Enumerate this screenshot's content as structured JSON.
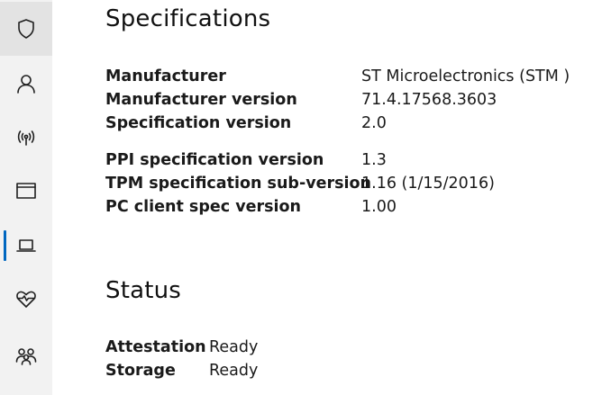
{
  "nav": {
    "items": [
      {
        "icon": "shield-icon"
      },
      {
        "icon": "person-icon"
      },
      {
        "icon": "wireless-icon"
      },
      {
        "icon": "app-window-icon"
      },
      {
        "icon": "laptop-icon"
      },
      {
        "icon": "heart-pulse-icon"
      },
      {
        "icon": "family-icon"
      }
    ],
    "active_indicator_color": "#0067c0"
  },
  "specifications": {
    "title": "Specifications",
    "rows": [
      {
        "label": "Manufacturer",
        "value": "ST Microelectronics (STM )"
      },
      {
        "label": "Manufacturer version",
        "value": "71.4.17568.3603"
      },
      {
        "label": "Specification version",
        "value": "2.0"
      },
      {
        "label": "PPI specification version",
        "value": "1.3"
      },
      {
        "label": "TPM specification sub-version",
        "value": "1.16 (1/15/2016)"
      },
      {
        "label": "PC client spec version",
        "value": "1.00"
      }
    ]
  },
  "status": {
    "title": "Status",
    "rows": [
      {
        "label": "Attestation",
        "value": "Ready"
      },
      {
        "label": "Storage",
        "value": "Ready"
      }
    ]
  }
}
